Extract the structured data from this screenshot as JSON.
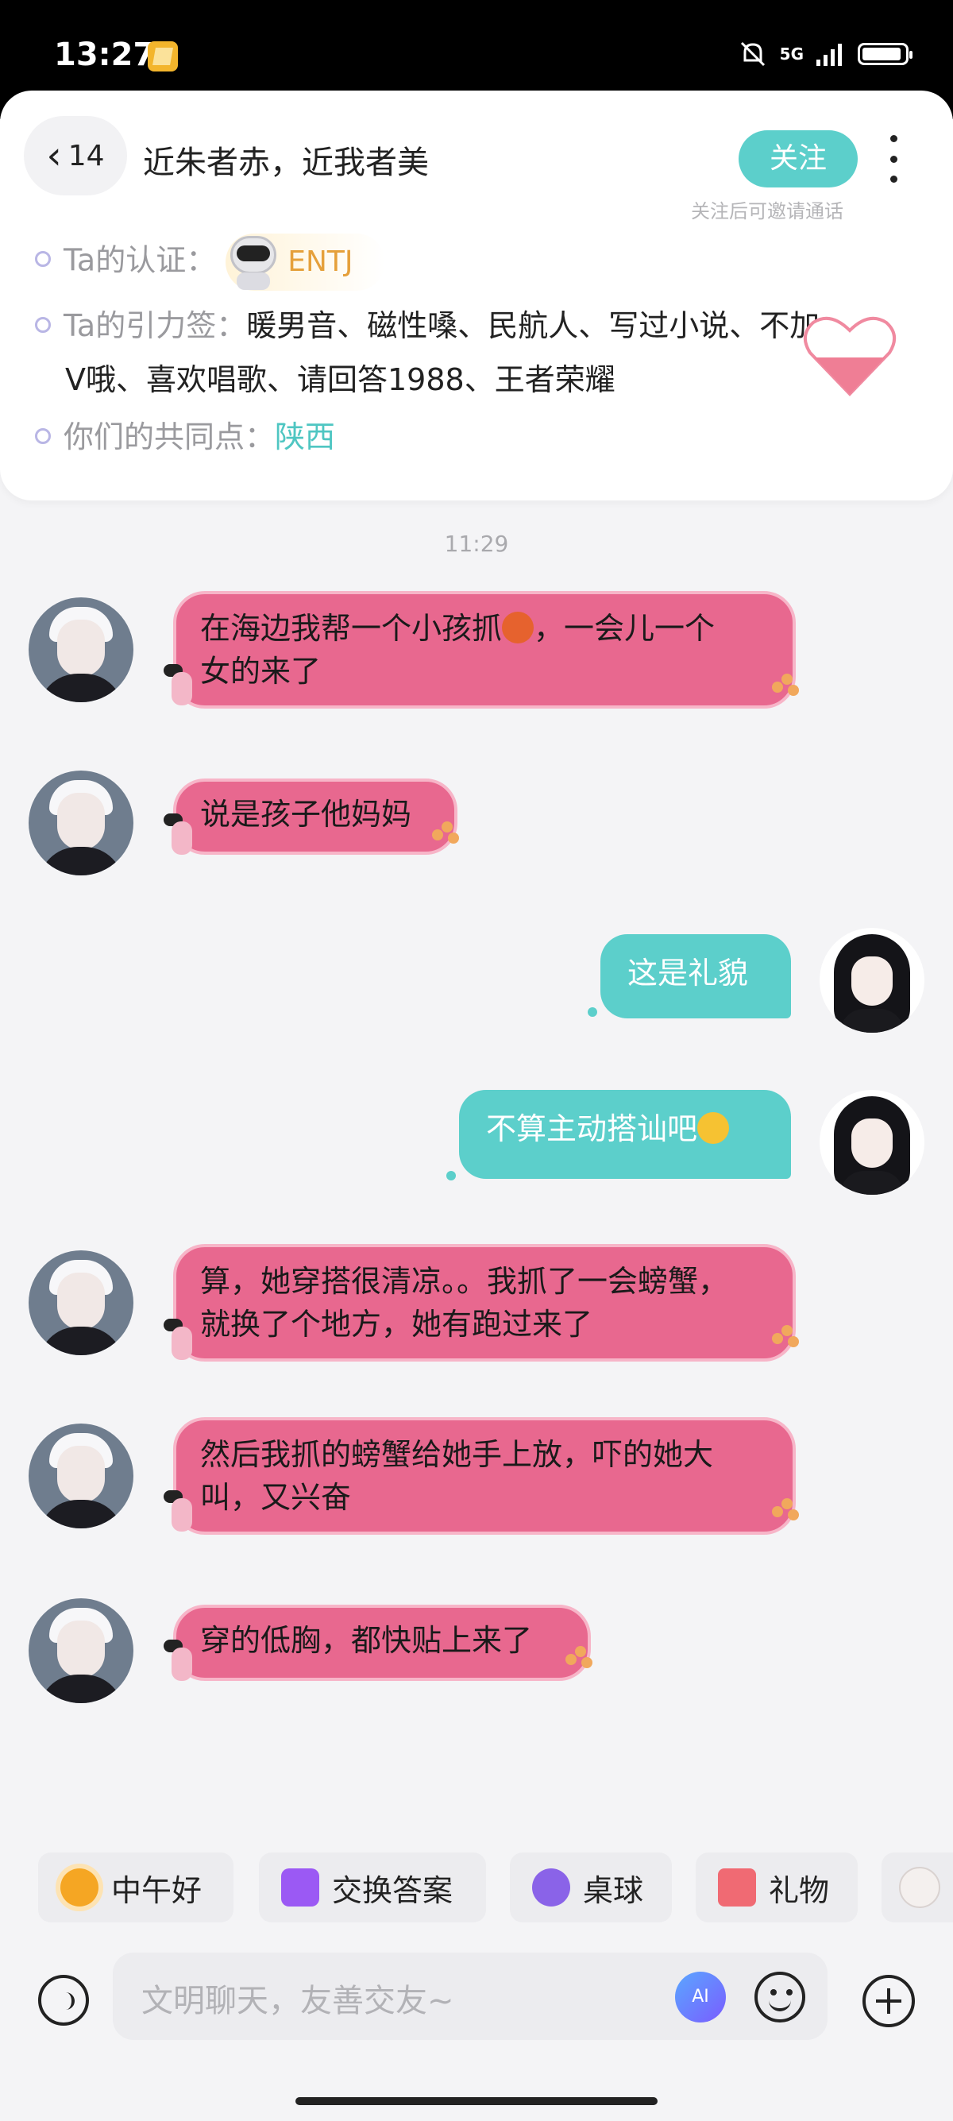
{
  "status_bar": {
    "time": "13:27",
    "network": "5G"
  },
  "header": {
    "unread_count": "14",
    "title": "近朱者赤，近我者美",
    "follow_label": "关注",
    "follow_hint": "关注后可邀请通话"
  },
  "profile_info": {
    "cert_label": "Ta的认证：",
    "cert_value": "ENTJ",
    "tags_label": "Ta的引力签：",
    "tags_line1": "暖男音、磁性嗓、民航人、写过小说、不加",
    "tags_line2": "V哦、喜欢唱歌、请回答1988、王者荣耀",
    "common_label": "你们的共同点：",
    "common_value": "陕西"
  },
  "timestamp": "11:29",
  "messages": [
    {
      "side": "in",
      "line1": "在海边我帮一个小孩抓",
      "line1_suffix": "，一会儿一个",
      "line2": "女的来了"
    },
    {
      "side": "in",
      "text": "说是孩子他妈妈"
    },
    {
      "side": "out",
      "text": "这是礼貌"
    },
    {
      "side": "out",
      "text": "不算主动搭讪吧"
    },
    {
      "side": "in",
      "line1": "算，她穿搭很清凉。。我抓了一会螃蟹，",
      "line2": "就换了个地方，她有跑过来了"
    },
    {
      "side": "in",
      "line1": "然后我抓的螃蟹给她手上放，吓的她大",
      "line2": "叫，又兴奋"
    },
    {
      "side": "in",
      "text": "穿的低胸，都快贴上来了"
    }
  ],
  "quick_actions": [
    {
      "label": "中午好",
      "icon": "sun-icon"
    },
    {
      "label": "交换答案",
      "icon": "swap-icon"
    },
    {
      "label": "桌球",
      "icon": "billiard-ball-icon"
    },
    {
      "label": "礼物",
      "icon": "gift-icon"
    }
  ],
  "input": {
    "placeholder": "文明聊天，友善交友~",
    "ai_label": "AI"
  },
  "colors": {
    "accent": "#5ccfcb",
    "incoming_bubble": "#e8688f",
    "incoming_border": "#f7b5c8"
  }
}
